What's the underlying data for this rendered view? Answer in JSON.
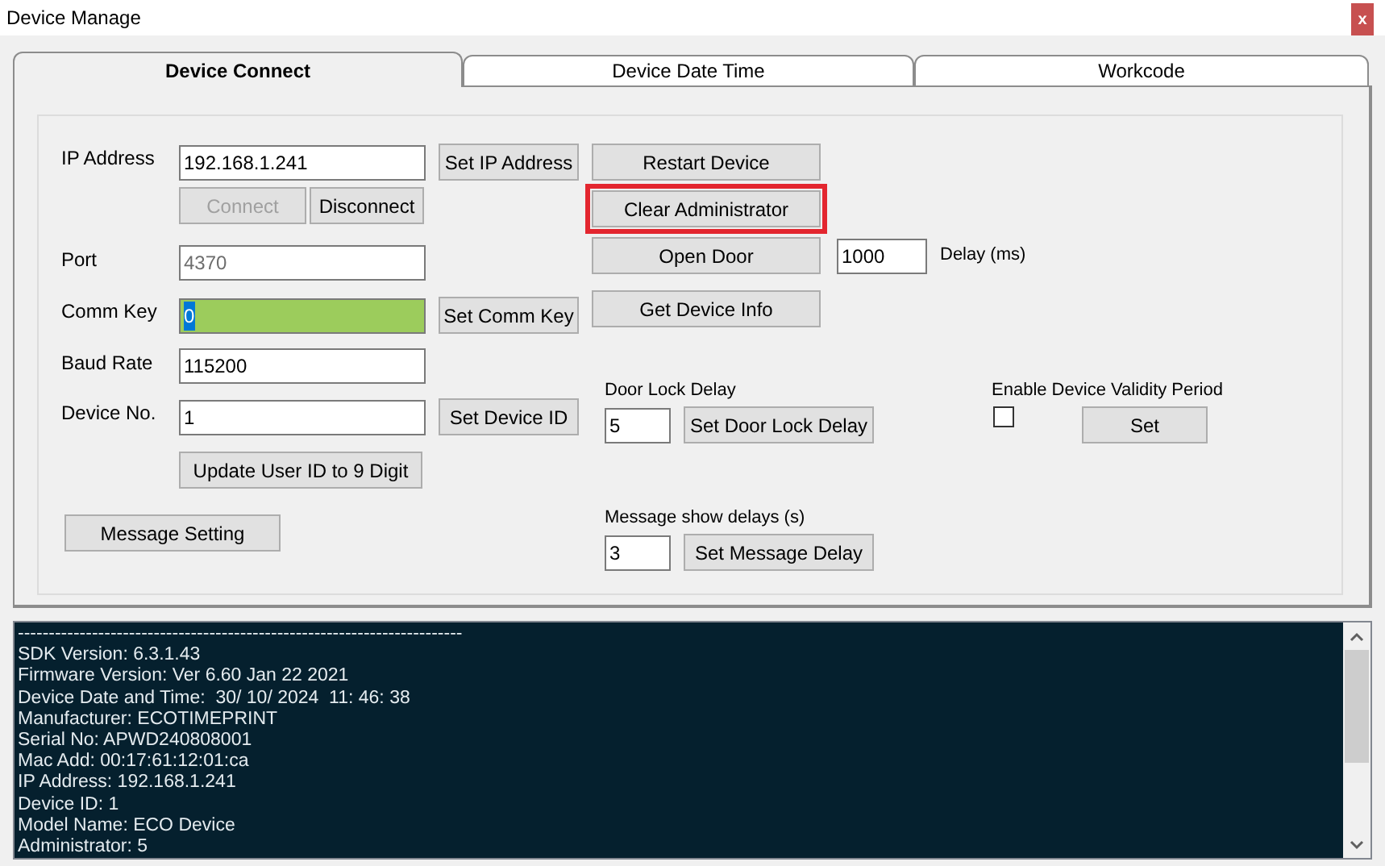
{
  "window": {
    "title": "Device Manage",
    "close": "x"
  },
  "tabs": [
    {
      "label": "Device Connect",
      "selected": true
    },
    {
      "label": "Device Date Time",
      "selected": false
    },
    {
      "label": "Workcode",
      "selected": false
    }
  ],
  "connection": {
    "ip_label": "IP Address",
    "ip_value": "192.168.1.241",
    "set_ip": "Set IP Address",
    "connect": {
      "label": "Connect",
      "disabled": true
    },
    "disconnect": {
      "label": "Disconnect",
      "disabled": false
    },
    "port_label": "Port",
    "port_value": "4370",
    "port_disabled": true,
    "comm_key_label": "Comm Key",
    "comm_key_value": "0",
    "comm_key_focused": true,
    "set_comm_key": "Set Comm Key",
    "baud_label": "Baud Rate",
    "baud_value": "115200",
    "device_no_label": "Device No.",
    "device_no_value": "1",
    "set_device_id": "Set Device ID",
    "update_user_id": "Update User ID to 9 Digit",
    "message_setting": "Message Setting"
  },
  "actions": [
    {
      "label": "Restart Device",
      "highlighted": false
    },
    {
      "label": "Clear Administrator",
      "highlighted": true
    },
    {
      "label": "Open Door",
      "highlighted": false
    },
    {
      "label": "Get Device Info",
      "highlighted": false
    }
  ],
  "open_door_delay": {
    "value": "1000",
    "label": "Delay (ms)"
  },
  "door_lock": {
    "label": "Door Lock Delay",
    "value": "5",
    "button": "Set Door Lock Delay"
  },
  "message_delay": {
    "label": "Message show delays (s)",
    "value": "3",
    "button": "Set Message Delay"
  },
  "validity": {
    "label": "Enable Device Validity Period",
    "checked": false,
    "button": "Set"
  },
  "log_lines": [
    "------------------------------------------------------------------------",
    "SDK Version: 6.3.1.43",
    "Firmware Version: Ver 6.60 Jan 22 2021",
    "Device Date and Time:  30/ 10/ 2024  11: 46: 38",
    "Manufacturer: ECOTIMEPRINT",
    "Serial No: APWD240808001",
    "Mac Add: 00:17:61:12:01:ca",
    "IP Address: 192.168.1.241",
    "Device ID: 1",
    "Model Name: ECO Device",
    "Administrator: 5"
  ]
}
